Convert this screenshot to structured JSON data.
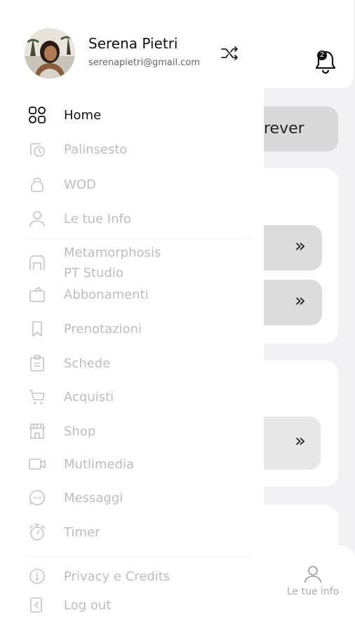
{
  "user": {
    "name": "Serena Pietri",
    "email": "serenapietri@gmail.com"
  },
  "menu": {
    "primary": [
      {
        "label": "Home",
        "icon": "grid-icon",
        "active": true
      },
      {
        "label": "Palinsesto",
        "icon": "calendar-clock-icon"
      },
      {
        "label": "WOD",
        "icon": "kettlebell-icon"
      },
      {
        "label": "Le tue Info",
        "icon": "user-icon"
      }
    ],
    "gym_name": "Metamorphosis\nPT Studio",
    "secondary": [
      {
        "label": "Abbonamenti",
        "icon": "ticket-icon"
      },
      {
        "label": "Prenotazioni",
        "icon": "bookmark-icon"
      },
      {
        "label": "Schede",
        "icon": "clipboard-icon"
      },
      {
        "label": "Acquisti",
        "icon": "cart-icon"
      },
      {
        "label": "Shop",
        "icon": "store-icon"
      },
      {
        "label": "Mutlimedia",
        "icon": "video-icon"
      },
      {
        "label": "Messaggi",
        "icon": "chat-icon"
      },
      {
        "label": "Timer",
        "icon": "stopwatch-icon"
      }
    ],
    "footer": [
      {
        "label": "Privacy e Credits",
        "icon": "info-icon"
      },
      {
        "label": "Log out",
        "icon": "logout-icon"
      }
    ]
  },
  "background": {
    "button_text": "rever",
    "notification_count": "2",
    "bottom_nav_label": "Le tue info"
  },
  "colors": {
    "active_text": "#111111",
    "inactive_text": "#bdbdbd",
    "drawer_bg": "#ffffff",
    "page_bg": "#f2f2f4"
  }
}
